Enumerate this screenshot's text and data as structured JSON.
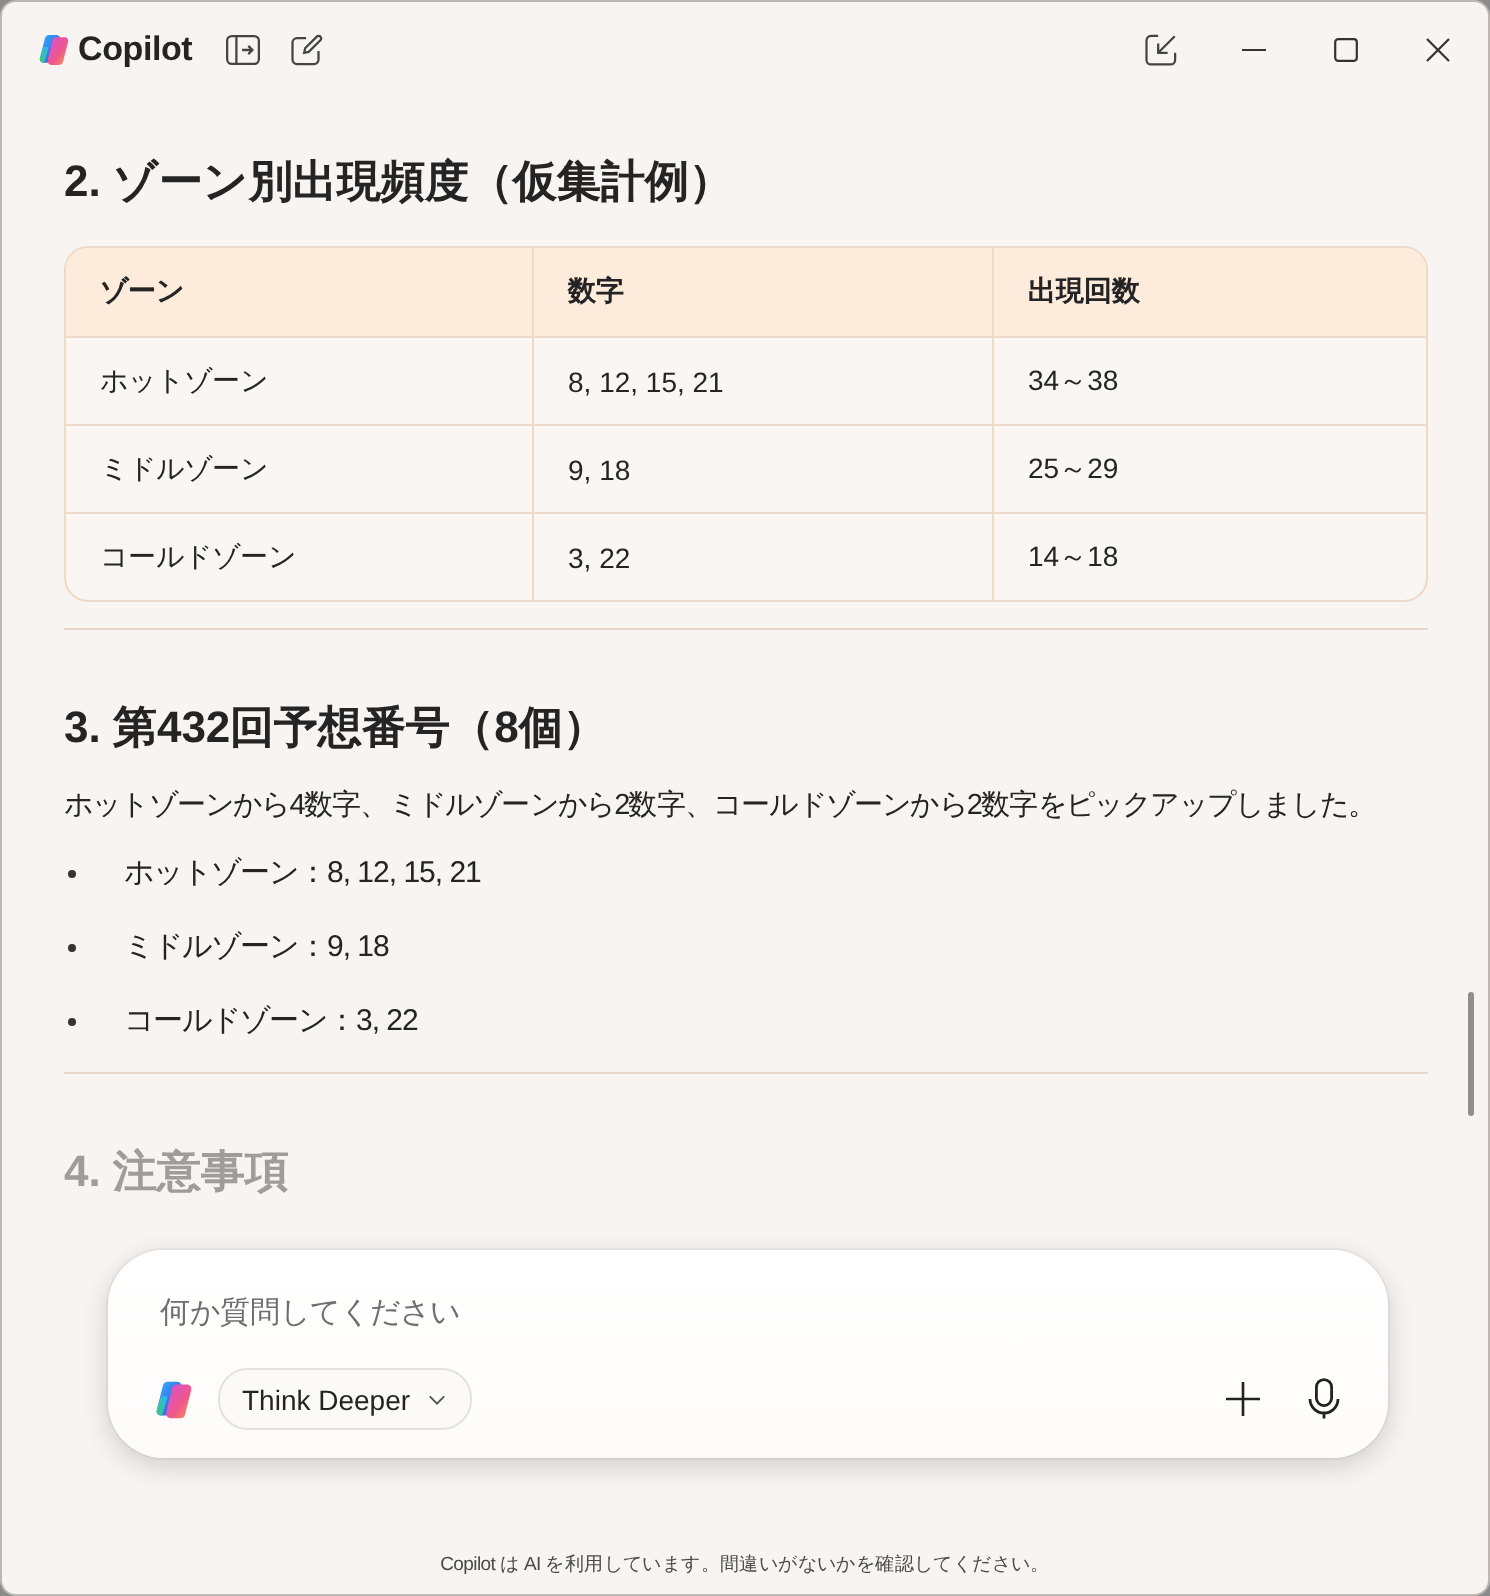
{
  "window": {
    "title": "Copilot"
  },
  "sections": [
    {
      "kind": "table",
      "faded": false,
      "heading": "2. ゾーン別出現頻度（仮集計例）",
      "table": {
        "columns": [
          "ゾーン",
          "数字",
          "出現回数"
        ],
        "rows": [
          [
            "ホットゾーン",
            "8, 12, 15, 21",
            "34～38"
          ],
          [
            "ミドルゾーン",
            "9, 18",
            "25～29"
          ],
          [
            "コールドゾーン",
            "3, 22",
            "14～18"
          ]
        ]
      }
    },
    {
      "kind": "list",
      "faded": false,
      "heading": "3. 第432回予想番号（8個）",
      "paragraph": "ホットゾーンから4数字、ミドルゾーンから2数字、コールドゾーンから2数字をピックアップしました。",
      "bullets": [
        "ホットゾーン：8, 12, 15, 21",
        "ミドルゾーン：9, 18",
        "コールドゾーン：3, 22"
      ]
    },
    {
      "kind": "heading",
      "faded": true,
      "heading": "4. 注意事項"
    }
  ],
  "composer": {
    "placeholder": "何か質問してください",
    "mode": "Think Deeper"
  },
  "footer": "Copilot は AI を利用しています。間違いがないかを確認してください。"
}
